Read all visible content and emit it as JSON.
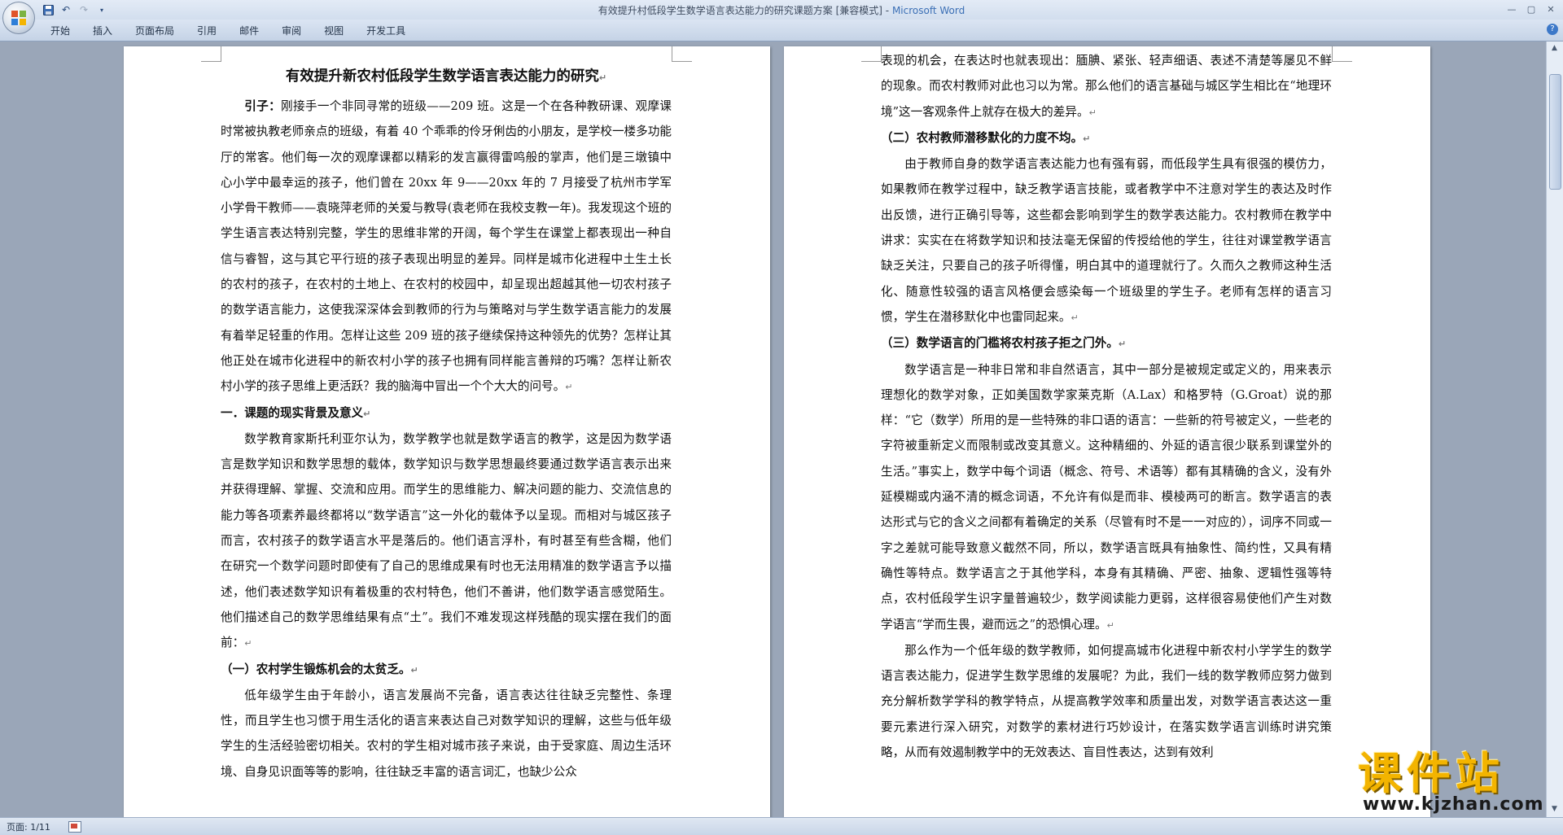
{
  "window": {
    "title": "有效提升村低段学生数学语言表达能力的研究课题方案 [兼容模式]",
    "app_name": "Microsoft Word"
  },
  "ribbon": {
    "tabs": [
      "开始",
      "插入",
      "页面布局",
      "引用",
      "邮件",
      "审阅",
      "视图",
      "开发工具"
    ]
  },
  "status": {
    "page_info": "页面: 1/11"
  },
  "watermark": {
    "logo_text": "课件站",
    "url": "www.kjzhan.com"
  },
  "page1": {
    "title": "有效提升新农村低段学生数学语言表达能力的研究",
    "paragraphs": [
      {
        "label": "引子：",
        "text": "刚接手一个非同寻常的班级——209 班。这是一个在各种教研课、观摩课时常被执教老师亲点的班级，有着 40 个乖乖的伶牙俐齿的小朋友，是学校一楼多功能厅的常客。他们每一次的观摩课都以精彩的发言赢得雷鸣般的掌声，他们是三墩镇中心小学中最幸运的孩子，他们曾在 20xx 年 9——20xx 年的 7 月接受了杭州市学军小学骨干教师——袁晓萍老师的关爱与教导(袁老师在我校支教一年)。我发现这个班的学生语言表达特别完整，学生的思维非常的开阔，每个学生在课堂上都表现出一种自信与睿智，这与其它平行班的孩子表现出明显的差异。同样是城市化进程中土生土长的农村的孩子，在农村的土地上、在农村的校园中，却呈现出超越其他一切农村孩子的数学语言能力，这使我深深体会到教师的行为与策略对与学生数学语言能力的发展有着举足轻重的作用。怎样让这些 209 班的孩子继续保持这种领先的优势？怎样让其他正处在城市化进程中的新农村小学的孩子也拥有同样能言善辩的巧嘴？怎样让新农村小学的孩子思维上更活跃？我的脑海中冒出一个个大大的问号。"
      },
      {
        "heading": "一．课题的现实背景及意义"
      },
      {
        "text": "数学教育家斯托利亚尔认为，数学教学也就是数学语言的教学，这是因为数学语言是数学知识和数学思想的载体，数学知识与数学思想最终要通过数学语言表示出来并获得理解、掌握、交流和应用。而学生的思维能力、解决问题的能力、交流信息的能力等各项素养最终都将以“数学语言”这一外化的载体予以呈现。而相对与城区孩子而言，农村孩子的数学语言水平是落后的。他们语言浮朴，有时甚至有些含糊，他们在研究一个数学问题时即使有了自己的思维成果有时也无法用精准的数学语言予以描述，他们表述数学知识有着极重的农村特色，他们不善讲，他们数学语言感觉陌生。他们描述自己的数学思维结果有点“土”。我们不难发现这样残酷的现实摆在我们的面前："
      },
      {
        "heading": "（一）农村学生锻炼机会的太贫乏。"
      },
      {
        "text": "低年级学生由于年龄小，语言发展尚不完备，语言表达往往缺乏完整性、条理性，而且学生也习惯于用生活化的语言来表达自己对数学知识的理解，这些与低年级学生的生活经验密切相关。农村的学生相对城市孩子来说，由于受家庭、周边生活环境、自身见识面等等的影响，往往缺乏丰富的语言词汇，也缺少公众"
      }
    ]
  },
  "page2": {
    "paragraphs": [
      {
        "text": "表现的机会，在表达时也就表现出：腼腆、紧张、轻声细语、表述不清楚等屡见不鲜的现象。而农村教师对此也习以为常。那么他们的语言基础与城区学生相比在“地理环境”这一客观条件上就存在极大的差异。",
        "noindent": true
      },
      {
        "heading": "（二）农村教师潜移默化的力度不均。"
      },
      {
        "text": "由于教师自身的数学语言表达能力也有强有弱，而低段学生具有很强的模仿力，如果教师在教学过程中，缺乏教学语言技能，或者教学中不注意对学生的表达及时作出反馈，进行正确引导等，这些都会影响到学生的数学表达能力。农村教师在教学中讲求：实实在在将数学知识和技法毫无保留的传授给他的学生，往往对课堂教学语言缺乏关注，只要自己的孩子听得懂，明白其中的道理就行了。久而久之教师这种生活化、随意性较强的语言风格便会感染每一个班级里的学生子。老师有怎样的语言习惯，学生在潜移默化中也雷同起来。"
      },
      {
        "heading": "（三）数学语言的门槛将农村孩子拒之门外。"
      },
      {
        "text": "数学语言是一种非日常和非自然语言，其中一部分是被规定或定义的，用来表示理想化的数学对象，正如美国数学家莱克斯（A.Lax）和格罗特（G.Groat）说的那样：“它（数学）所用的是一些特殊的非口语的语言：一些新的符号被定义，一些老的字符被重新定义而限制或改变其意义。这种精细的、外延的语言很少联系到课堂外的生活。”事实上，数学中每个词语（概念、符号、术语等）都有其精确的含义，没有外延模糊或内涵不清的概念词语，不允许有似是而非、模棱两可的断言。数学语言的表达形式与它的含义之间都有着确定的关系（尽管有时不是一一对应的），词序不同或一字之差就可能导致意义截然不同，所以，数学语言既具有抽象性、简约性，又具有精确性等特点。数学语言之于其他学科，本身有其精确、严密、抽象、逻辑性强等特点，农村低段学生识字量普遍较少，数学阅读能力更弱，这样很容易使他们产生对数学语言“学而生畏，避而远之”的恐惧心理。"
      },
      {
        "text": "那么作为一个低年级的数学教师，如何提高城市化进程中新农村小学学生的数学语言表达能力，促进学生数学思维的发展呢？为此，我们一线的数学教师应努力做到充分解析数学学科的教学特点，从提高教学效率和质量出发，对数学语言表达这一重要元素进行深入研究，对数学的素材进行巧妙设计，在落实数学语言训练时讲究策略，从而有效遏制教学中的无效表达、盲目性表达，达到有效利"
      }
    ]
  },
  "icons": {
    "office_button": "office-logo-icon",
    "save": "save-icon",
    "undo": "undo-icon",
    "redo": "redo-icon",
    "qat_more": "chevron-down-icon",
    "minimize": "minimize-icon",
    "maximize": "maximize-icon",
    "close": "close-icon",
    "help": "help-icon",
    "paragraph_mark": "paragraph-mark-icon"
  },
  "colors": {
    "app_name": "#3b6fb5",
    "workspace": "#9aa6b8",
    "watermark": "#f3b400"
  }
}
